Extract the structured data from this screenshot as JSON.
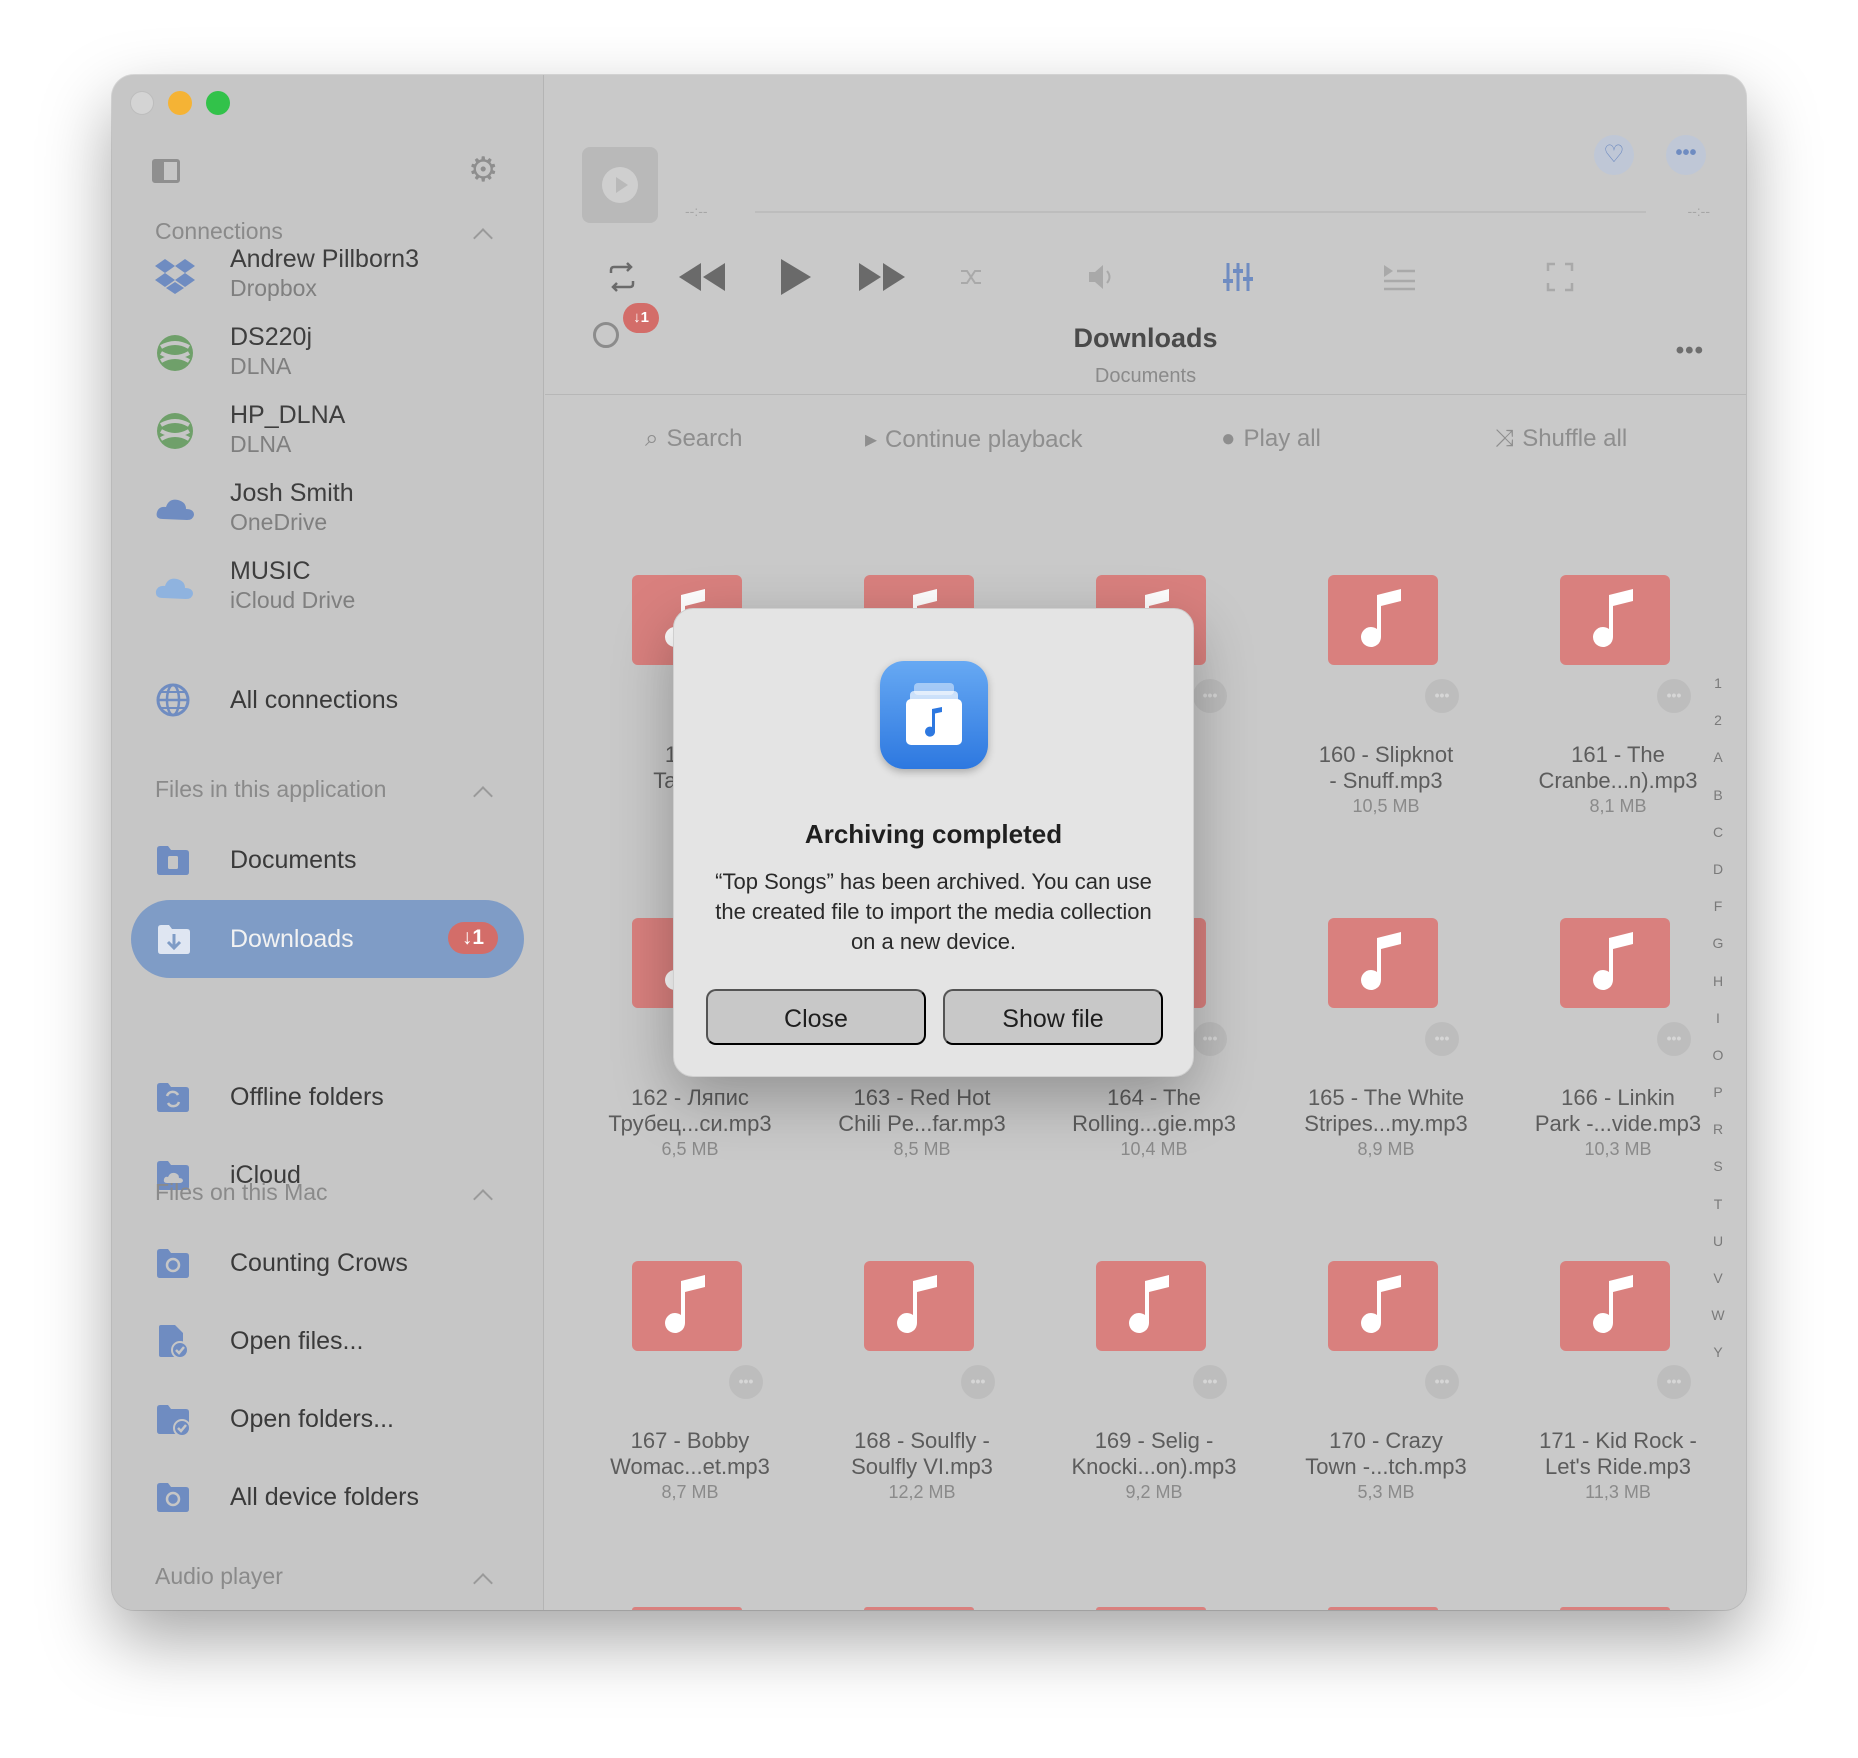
{
  "sidebar": {
    "sections": {
      "connections": "Connections",
      "app_files": "Files in this application",
      "mac_files": "Files on this Mac",
      "audio_player": "Audio player"
    },
    "connections": [
      {
        "name": "Andrew Pillborn3",
        "service": "Dropbox",
        "icon": "dropbox-icon"
      },
      {
        "name": "DS220j",
        "service": "DLNA",
        "icon": "dlna-icon"
      },
      {
        "name": "HP_DLNA",
        "service": "DLNA",
        "icon": "dlna-icon"
      },
      {
        "name": "Josh Smith",
        "service": "OneDrive",
        "icon": "onedrive-icon"
      },
      {
        "name": "MUSIC",
        "service": "iCloud Drive",
        "icon": "icloud-icon"
      }
    ],
    "all_connections": "All connections",
    "app_items": [
      {
        "label": "Documents",
        "icon": "documents-folder-icon"
      },
      {
        "label": "Downloads",
        "icon": "downloads-folder-icon",
        "badge": "↓1",
        "active": true
      },
      {
        "label": "Offline folders",
        "icon": "offline-folder-icon"
      },
      {
        "label": "iCloud",
        "icon": "icloud-folder-icon"
      }
    ],
    "mac_items": [
      {
        "label": "Counting Crows",
        "icon": "linked-folder-icon"
      },
      {
        "label": "Open files...",
        "icon": "open-file-icon"
      },
      {
        "label": "Open folders...",
        "icon": "open-folder-icon"
      },
      {
        "label": "All device folders",
        "icon": "device-folders-icon"
      }
    ]
  },
  "player": {
    "time_elapsed": "--:--",
    "time_remaining": "--:--"
  },
  "header": {
    "title": "Downloads",
    "subtitle": "Documents",
    "sync_badge": "↓1"
  },
  "actions": {
    "search": "Search",
    "continue": "Continue playback",
    "play_all": "Play all",
    "shuffle_all": "Shuffle all"
  },
  "files": [
    {
      "line1": "157 - ",
      "line2": "Tarantu",
      "size": "9,"
    },
    {
      "line1": "",
      "line2": "",
      "size": ""
    },
    {
      "line1": "ver",
      "line2": "mp3",
      "size": ""
    },
    {
      "line1": "160 - Slipknot",
      "line2": "- Snuff.mp3",
      "size": "10,5 MB"
    },
    {
      "line1": "161 - The",
      "line2": "Cranbe...n).mp3",
      "size": "8,1 MB"
    },
    {
      "line1": "162 - Ляпис",
      "line2": "Трубец...си.mp3",
      "size": "6,5 MB"
    },
    {
      "line1": "163 - Red Hot",
      "line2": "Chili Pe...far.mp3",
      "size": "8,5 MB"
    },
    {
      "line1": "164 - The",
      "line2": "Rolling...gie.mp3",
      "size": "10,4 MB"
    },
    {
      "line1": "165 - The White",
      "line2": "Stripes...my.mp3",
      "size": "8,9 MB"
    },
    {
      "line1": "166 - Linkin",
      "line2": "Park -...vide.mp3",
      "size": "10,3 MB"
    },
    {
      "line1": "167 - Bobby",
      "line2": "Womac...et.mp3",
      "size": "8,7 MB"
    },
    {
      "line1": "168 - Soulfly -",
      "line2": "Soulfly VI.mp3",
      "size": "12,2 MB"
    },
    {
      "line1": "169 - Selig -",
      "line2": "Knocki...on).mp3",
      "size": "9,2 MB"
    },
    {
      "line1": "170 - Crazy",
      "line2": "Town -...tch.mp3",
      "size": "5,3 MB"
    },
    {
      "line1": "171 - Kid Rock -",
      "line2": "Let's Ride.mp3",
      "size": "11,3 MB"
    }
  ],
  "alphabet": [
    "1",
    "2",
    "A",
    "B",
    "C",
    "D",
    "F",
    "G",
    "H",
    "I",
    "O",
    "P",
    "R",
    "S",
    "T",
    "U",
    "V",
    "W",
    "Y"
  ],
  "dialog": {
    "title": "Archiving completed",
    "message": "“Top Songs” has been archived. You can use the created file to import the media collection on a new device.",
    "close": "Close",
    "show_file": "Show file"
  },
  "colors": {
    "accent": "#7f9cc6",
    "badge": "#d36d69",
    "thumb": "#d9807e",
    "dialog_icon": "#2d78e0"
  }
}
